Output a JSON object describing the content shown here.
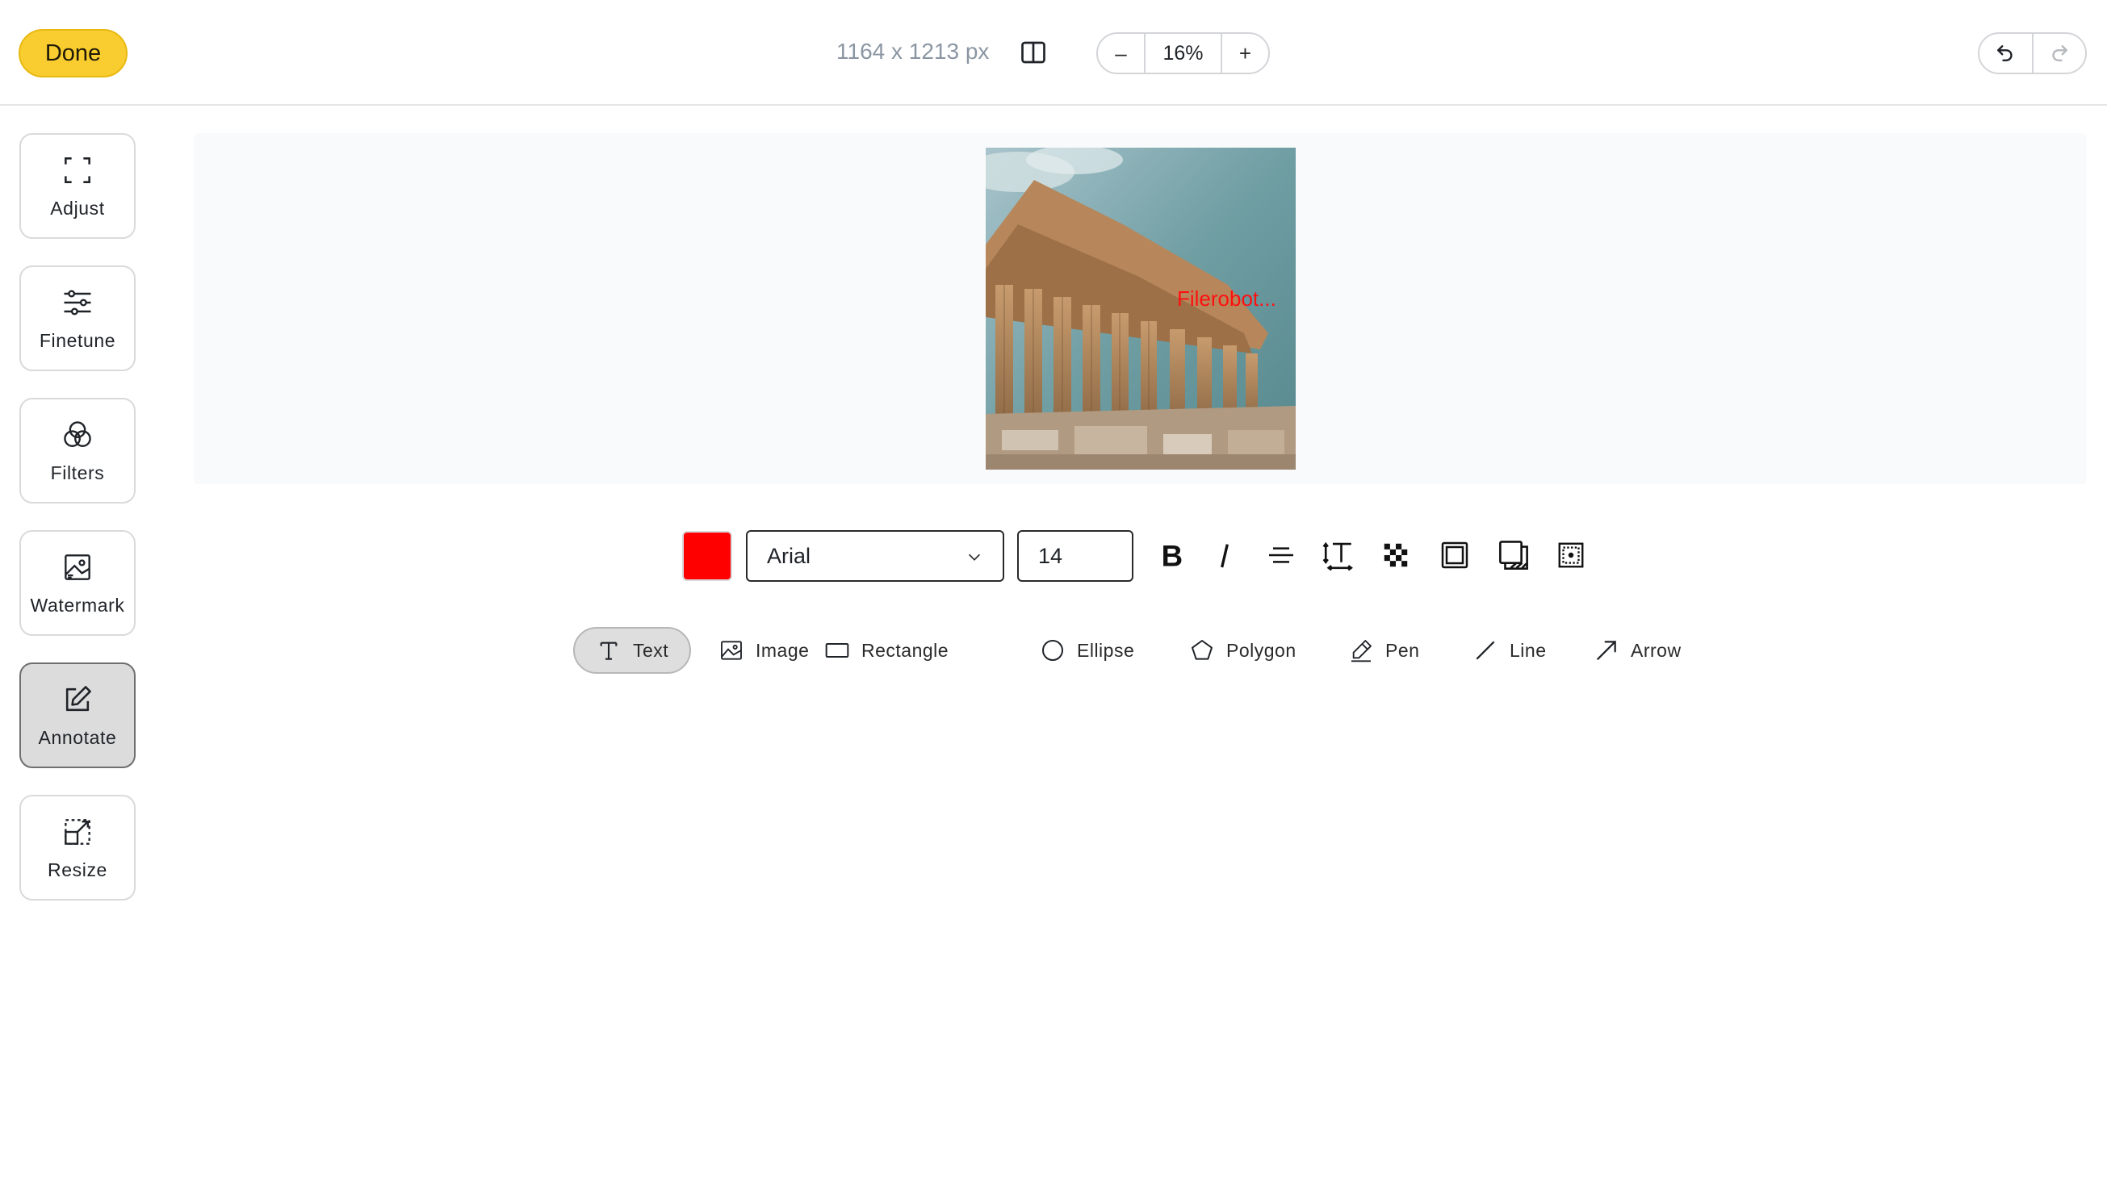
{
  "topbar": {
    "done_label": "Done",
    "dimensions": "1164 x 1213 px",
    "zoom": {
      "decrease": "–",
      "value": "16%",
      "increase": "+"
    },
    "compare_icon": "split-view-icon",
    "undo_icon": "undo-icon",
    "redo_icon": "redo-icon"
  },
  "sidebar": {
    "items": [
      {
        "label": "Adjust",
        "icon": "crop-corners-icon",
        "active": false
      },
      {
        "label": "Finetune",
        "icon": "sliders-icon",
        "active": false
      },
      {
        "label": "Filters",
        "icon": "color-circles-icon",
        "active": false
      },
      {
        "label": "Watermark",
        "icon": "image-watermark-icon",
        "active": false
      },
      {
        "label": "Annotate",
        "icon": "edit-pencil-icon",
        "active": true
      },
      {
        "label": "Resize",
        "icon": "resize-icon",
        "active": false
      }
    ]
  },
  "canvas": {
    "overlay_text": "Filerobot..."
  },
  "text_toolbar": {
    "color": "#ff0000",
    "font_family": "Arial",
    "font_size": "14",
    "buttons": [
      "bold-icon",
      "italic-icon",
      "align-icon",
      "line-height-icon",
      "opacity-icon",
      "stroke-icon",
      "shadow-icon",
      "position-icon"
    ]
  },
  "shape_tools": [
    {
      "label": "Text",
      "icon": "text-icon",
      "active": true
    },
    {
      "label": "Image",
      "icon": "image-icon",
      "active": false
    },
    {
      "label": "Rectangle",
      "icon": "rectangle-icon",
      "active": false
    },
    {
      "label": "Ellipse",
      "icon": "ellipse-icon",
      "active": false
    },
    {
      "label": "Polygon",
      "icon": "polygon-icon",
      "active": false
    },
    {
      "label": "Pen",
      "icon": "pen-icon",
      "active": false
    },
    {
      "label": "Line",
      "icon": "line-icon",
      "active": false
    },
    {
      "label": "Arrow",
      "icon": "arrow-icon",
      "active": false
    }
  ],
  "colors": {
    "accent": "#f9cc2f",
    "annotation": "#ff0000",
    "canvas_bg": "#f9fafb",
    "active_tool_bg": "#dcdcdc"
  }
}
